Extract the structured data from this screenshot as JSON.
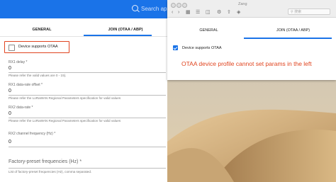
{
  "left_window": {
    "search_placeholder": "Search app",
    "tabs": [
      {
        "label": "GENERAL"
      },
      {
        "label": "JOIN (OTAA / ABP)"
      }
    ],
    "otaa_checkbox": {
      "label": "Device supports OTAA",
      "checked": false
    },
    "fields": [
      {
        "label": "RX1 delay *",
        "value": "0",
        "help": "Please refer the valid values are 0 - 15)."
      },
      {
        "label": "RX1 data-rate offset *",
        "value": "0",
        "help": "Please refer the LoRaWAN Regional Parameters specification for valid values"
      },
      {
        "label": "RX2 data-rate *",
        "value": "0",
        "help": "Please refer the LoRaWAN Regional Parameters specification for valid values"
      },
      {
        "label": "RX2 channel frequency (Hz) *",
        "value": "0",
        "help": ""
      }
    ],
    "factory_freq": {
      "label": "Factory-preset frequencies (Hz) *",
      "help": "List of factory-preset frequencies (Hz), comma separated."
    }
  },
  "right_window": {
    "title": "Zang",
    "search_placeholder": "搜索",
    "tabs": [
      {
        "label": "GENERAL"
      },
      {
        "label": "JOIN (OTAA / ABP)"
      }
    ],
    "otaa_checkbox": {
      "label": "Device supports OTAA",
      "checked": true
    },
    "annotation": "OTAA device profile cannot set params in the left"
  },
  "colors": {
    "accent": "#1a73e8",
    "annotation": "#e0441f"
  }
}
